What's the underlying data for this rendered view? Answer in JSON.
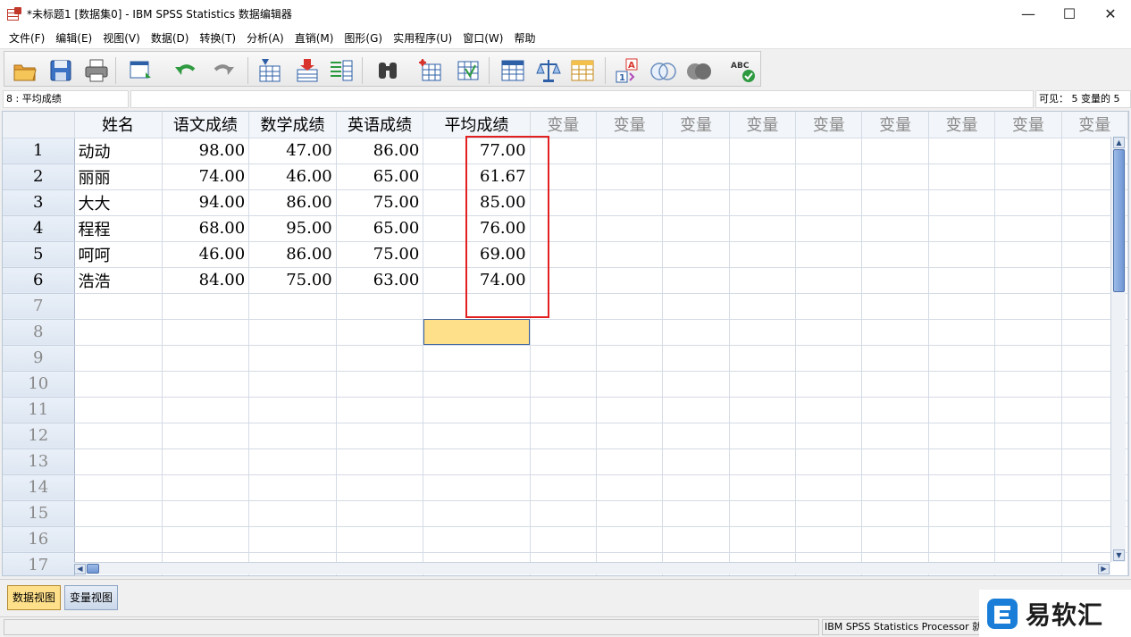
{
  "window": {
    "title": "*未标题1 [数据集0] - IBM SPSS Statistics 数据编辑器",
    "controls": {
      "minimize": "—",
      "maximize": "☐",
      "close": "✕"
    }
  },
  "menu": [
    "文件(F)",
    "编辑(E)",
    "视图(V)",
    "数据(D)",
    "转换(T)",
    "分析(A)",
    "直销(M)",
    "图形(G)",
    "实用程序(U)",
    "窗口(W)",
    "帮助"
  ],
  "toolbar_icons": [
    "open-folder-icon",
    "save-icon",
    "print-icon",
    "dialog-recall-icon",
    "undo-icon",
    "redo-icon",
    "goto-case-icon",
    "goto-variable-icon",
    "variables-icon",
    "find-icon",
    "insert-cases-icon",
    "insert-variable-icon",
    "split-file-icon",
    "weight-cases-icon",
    "select-cases-icon",
    "value-labels-icon",
    "use-sets-icon",
    "show-all-variables-icon",
    "spell-check-icon"
  ],
  "cell_editor": {
    "reference": "8 : 平均成绩",
    "value": "",
    "visible_info": "可见： 5 变量的 5"
  },
  "grid": {
    "columns": [
      "姓名",
      "语文成绩",
      "数学成绩",
      "英语成绩",
      "平均成绩",
      "变量",
      "变量",
      "变量",
      "变量",
      "变量",
      "变量",
      "变量",
      "变量",
      "变量"
    ],
    "rows": [
      {
        "num": "1",
        "cells": [
          "动动",
          "98.00",
          "47.00",
          "86.00",
          "77.00"
        ]
      },
      {
        "num": "2",
        "cells": [
          "丽丽",
          "74.00",
          "46.00",
          "65.00",
          "61.67"
        ]
      },
      {
        "num": "3",
        "cells": [
          "大大",
          "94.00",
          "86.00",
          "75.00",
          "85.00"
        ]
      },
      {
        "num": "4",
        "cells": [
          "程程",
          "68.00",
          "95.00",
          "65.00",
          "76.00"
        ]
      },
      {
        "num": "5",
        "cells": [
          "呵呵",
          "46.00",
          "86.00",
          "75.00",
          "69.00"
        ]
      },
      {
        "num": "6",
        "cells": [
          "浩浩",
          "84.00",
          "75.00",
          "63.00",
          "74.00"
        ]
      }
    ],
    "empty_rows": [
      "7",
      "8",
      "9",
      "10",
      "11",
      "12",
      "13",
      "14",
      "15",
      "16",
      "17"
    ],
    "selected": {
      "row": "8",
      "column": "平均成绩"
    },
    "highlight_color": "#e32020",
    "selection_color": "#ffe08a"
  },
  "tabs": {
    "data_view": "数据视图",
    "variable_view": "变量视图",
    "active": "data_view"
  },
  "status": {
    "processor": "IBM SPSS Statistics Processor 就绪"
  },
  "watermark": {
    "text": "易软汇"
  }
}
